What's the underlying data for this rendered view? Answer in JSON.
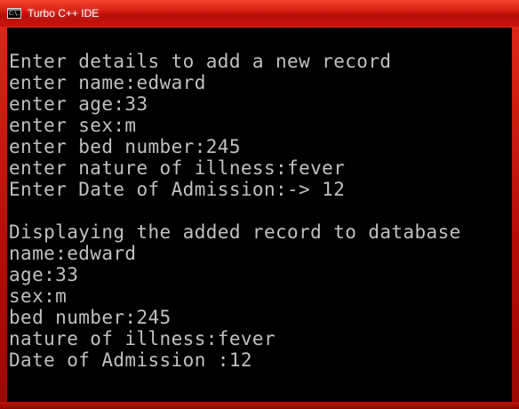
{
  "window": {
    "title": "Turbo C++ IDE",
    "icon": "console-window-icon",
    "icon_text": "C:\\."
  },
  "console": {
    "lines": [
      "Enter details to add a new record",
      "enter name:edward",
      "enter age:33",
      "enter sex:m",
      "enter bed number:245",
      "enter nature of illness:fever",
      "Enter Date of Admission:-> 12",
      "",
      "Displaying the added record to database",
      "name:edward",
      "age:33",
      "sex:m",
      "bed number:245",
      "nature of illness:fever",
      "Date of Admission :12"
    ]
  },
  "colors": {
    "titlebar": "#d3190f",
    "console_background": "#000000",
    "console_text": "#c0c0c0"
  }
}
